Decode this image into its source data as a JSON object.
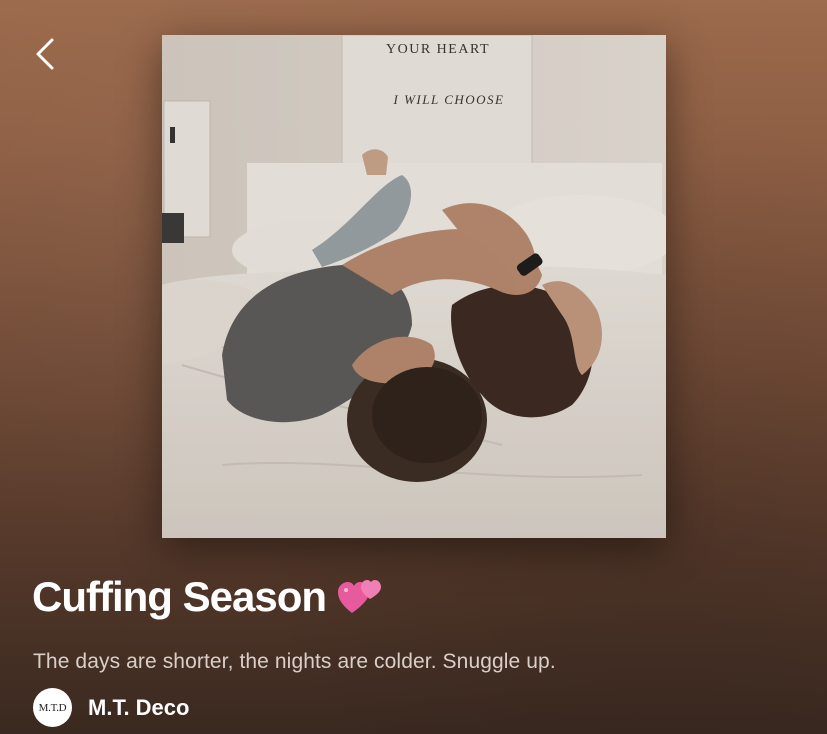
{
  "cover": {
    "poster_line_1": "YOUR HEART",
    "poster_line_2": "I WILL CHOOSE"
  },
  "playlist": {
    "title": "Cuffing Season",
    "emoji_icon": "two-hearts-icon",
    "description": "The days are shorter, the nights are colder. Snuggle up."
  },
  "owner": {
    "avatar_text": "M.T.D",
    "name": "M.T. Deco"
  },
  "nav": {
    "back_icon": "chevron-left-icon"
  },
  "colors": {
    "background_top": "#9c6a4c",
    "background_bottom": "#3a2920",
    "heart_pink": "#e85a9e"
  }
}
